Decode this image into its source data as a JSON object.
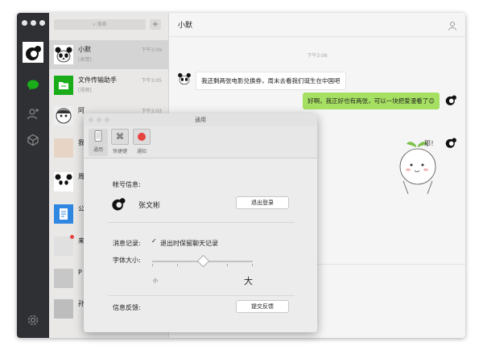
{
  "sidebar": {
    "icons": [
      "chat-icon",
      "contacts-icon",
      "favorites-icon",
      "settings-icon"
    ]
  },
  "session_list": {
    "search_placeholder": "搜索",
    "add_label": "+",
    "items": [
      {
        "name": "小默",
        "time": "下午3:09",
        "preview": "[表情]",
        "selected": true
      },
      {
        "name": "文件传输助手",
        "time": "下午3:05",
        "preview": "[视频]"
      },
      {
        "name": "阿",
        "time": "下午3:03",
        "preview": ""
      },
      {
        "name": "我",
        "time": "",
        "preview": ""
      },
      {
        "name": "周",
        "time": "",
        "preview": ""
      },
      {
        "name": "公",
        "time": "",
        "preview": ""
      },
      {
        "name": "来",
        "time": "",
        "preview": "",
        "badge": true
      },
      {
        "name": "P",
        "time": "",
        "preview": ""
      },
      {
        "name": "孙",
        "time": "",
        "preview": ""
      }
    ]
  },
  "chat": {
    "title": "小默",
    "timestamp": "下午3:08",
    "messages": [
      {
        "dir": "in",
        "text": "我还剩两张电影兑换券，周末去看我们诞生在中国吧"
      },
      {
        "dir": "out",
        "text": "好啊，我正好也有两张，可以一块把爱漫看了😊"
      }
    ],
    "sticker_text": "耶！"
  },
  "dialog": {
    "title": "通用",
    "tabs": [
      {
        "label": "通用",
        "icon": "phone-icon",
        "selected": true
      },
      {
        "label": "快捷键",
        "icon": "command-icon"
      },
      {
        "label": "通知",
        "icon": "record-icon"
      }
    ],
    "account_label": "帐号信息:",
    "account_name": "张文彬",
    "logout_button": "退出登录",
    "history_label": "消息记录:",
    "history_checkbox": "退出时保留聊天记录",
    "history_checked": true,
    "font_label": "字体大小:",
    "font_small": "小",
    "font_large": "大",
    "font_level": 0.5,
    "feedback_label": "信息反馈:",
    "feedback_button": "提交反馈"
  },
  "colors": {
    "sidebar": "#2e3034",
    "accent_green": "#1aad19",
    "bubble_out": "#a6e062",
    "record_red": "#e64340"
  }
}
